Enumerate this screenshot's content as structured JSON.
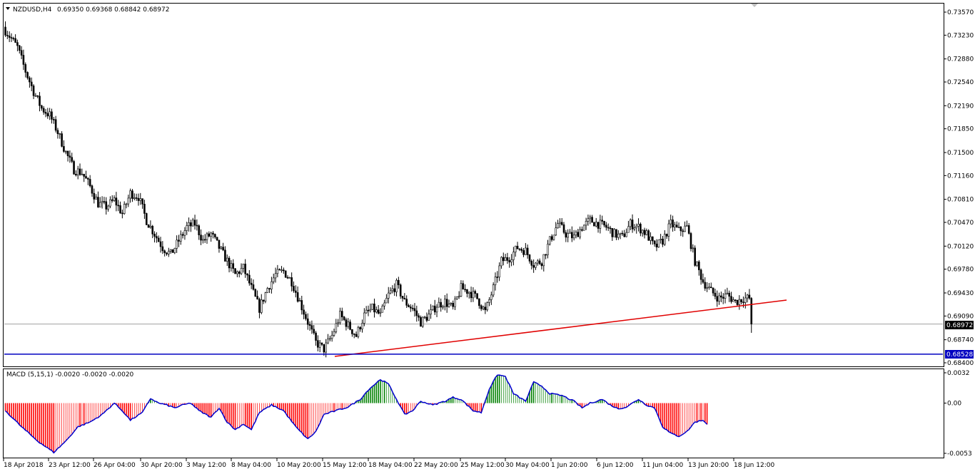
{
  "header": {
    "symbol": "NZDUSD,H4",
    "ohlc": "0.69350 0.69368 0.68842 0.68972"
  },
  "indicator": {
    "label": "MACD (5,15,1) -0.0020 -0.0020 -0.0020"
  },
  "colors": {
    "candle": "#000000",
    "trendline": "#e00000",
    "support": "#0000c0",
    "macd_up": "#008000",
    "macd_down": "#ff0000",
    "signal": "#0000cc",
    "bid_line": "#a0a0a0"
  },
  "chart_data": [
    {
      "type": "candlestick",
      "symbol": "NZDUSD",
      "timeframe": "H4",
      "ylim": [
        0.684,
        0.73717
      ],
      "y_ticks": [
        "0.73570",
        "0.73230",
        "0.72880",
        "0.72540",
        "0.72190",
        "0.71850",
        "0.71500",
        "0.71160",
        "0.70810",
        "0.70470",
        "0.70120",
        "0.69780",
        "0.69430",
        "0.69090",
        "0.68740",
        "0.68400"
      ],
      "x_ticks": [
        "18 Apr 2018",
        "23 Apr 12:00",
        "26 Apr 04:00",
        "30 Apr 20:00",
        "3 May 12:00",
        "8 May 04:00",
        "10 May 20:00",
        "15 May 12:00",
        "18 May 04:00",
        "22 May 20:00",
        "25 May 12:00",
        "30 May 04:00",
        "1 Jun 20:00",
        "6 Jun 12:00",
        "11 Jun 04:00",
        "13 Jun 20:00",
        "18 Jun 12:00"
      ],
      "current_price": "0.68972",
      "support_level": "0.68528",
      "trendline": {
        "start": [
          "15 May 12:00",
          0.6852
        ],
        "end": [
          "20 Jun",
          0.6932
        ]
      },
      "close_path": [
        [
          0,
          0.733
        ],
        [
          3,
          0.7318
        ],
        [
          6,
          0.7305
        ],
        [
          10,
          0.727
        ],
        [
          14,
          0.724
        ],
        [
          18,
          0.7215
        ],
        [
          22,
          0.7205
        ],
        [
          26,
          0.718
        ],
        [
          30,
          0.715
        ],
        [
          34,
          0.7125
        ],
        [
          38,
          0.712
        ],
        [
          42,
          0.71
        ],
        [
          46,
          0.7075
        ],
        [
          50,
          0.707
        ],
        [
          54,
          0.708
        ],
        [
          58,
          0.706
        ],
        [
          62,
          0.709
        ],
        [
          66,
          0.7085
        ],
        [
          70,
          0.705
        ],
        [
          74,
          0.703
        ],
        [
          78,
          0.701
        ],
        [
          82,
          0.7
        ],
        [
          86,
          0.702
        ],
        [
          90,
          0.704
        ],
        [
          94,
          0.7045
        ],
        [
          98,
          0.702
        ],
        [
          102,
          0.703
        ],
        [
          106,
          0.701
        ],
        [
          110,
          0.699
        ],
        [
          114,
          0.697
        ],
        [
          118,
          0.698
        ],
        [
          122,
          0.695
        ],
        [
          126,
          0.692
        ],
        [
          130,
          0.695
        ],
        [
          134,
          0.697
        ],
        [
          138,
          0.6975
        ],
        [
          142,
          0.696
        ],
        [
          146,
          0.693
        ],
        [
          150,
          0.69
        ],
        [
          154,
          0.687
        ],
        [
          158,
          0.686
        ],
        [
          162,
          0.688
        ],
        [
          166,
          0.691
        ],
        [
          170,
          0.6895
        ],
        [
          174,
          0.688
        ],
        [
          178,
          0.691
        ],
        [
          182,
          0.692
        ],
        [
          186,
          0.691
        ],
        [
          190,
          0.694
        ],
        [
          194,
          0.6955
        ],
        [
          198,
          0.693
        ],
        [
          202,
          0.692
        ],
        [
          206,
          0.69
        ],
        [
          210,
          0.691
        ],
        [
          214,
          0.6925
        ],
        [
          218,
          0.693
        ],
        [
          222,
          0.692
        ],
        [
          226,
          0.695
        ],
        [
          230,
          0.6945
        ],
        [
          234,
          0.6935
        ],
        [
          238,
          0.6915
        ],
        [
          242,
          0.695
        ],
        [
          246,
          0.699
        ],
        [
          250,
          0.6995
        ],
        [
          254,
          0.701
        ],
        [
          258,
          0.7005
        ],
        [
          262,
          0.6985
        ],
        [
          266,
          0.699
        ],
        [
          270,
          0.702
        ],
        [
          274,
          0.7045
        ],
        [
          278,
          0.703
        ],
        [
          282,
          0.7025
        ],
        [
          286,
          0.704
        ],
        [
          290,
          0.705
        ],
        [
          294,
          0.7045
        ],
        [
          298,
          0.704
        ],
        [
          302,
          0.703
        ],
        [
          306,
          0.7025
        ],
        [
          310,
          0.7045
        ],
        [
          314,
          0.704
        ],
        [
          318,
          0.703
        ],
        [
          322,
          0.701
        ],
        [
          326,
          0.702
        ],
        [
          330,
          0.7045
        ],
        [
          334,
          0.7035
        ],
        [
          338,
          0.704
        ],
        [
          342,
          0.699
        ],
        [
          346,
          0.696
        ],
        [
          350,
          0.6945
        ],
        [
          354,
          0.6935
        ],
        [
          358,
          0.694
        ],
        [
          362,
          0.693
        ],
        [
          366,
          0.6935
        ],
        [
          369,
          0.6935
        ],
        [
          370,
          0.68972
        ]
      ]
    },
    {
      "type": "histogram",
      "name": "MACD (5,15,1)",
      "values_text": "-0.0020 -0.0020 -0.0020",
      "ylim": [
        -0.0055,
        0.0033
      ],
      "y_ticks": [
        "0.0032",
        "0.00",
        "-0.0053"
      ],
      "anchors": [
        [
          0,
          -0.0008
        ],
        [
          8,
          -0.0025
        ],
        [
          16,
          -0.004
        ],
        [
          24,
          -0.0052
        ],
        [
          30,
          -0.004
        ],
        [
          36,
          -0.0025
        ],
        [
          42,
          -0.002
        ],
        [
          48,
          -0.0012
        ],
        [
          54,
          0.0
        ],
        [
          58,
          -0.0008
        ],
        [
          62,
          -0.0018
        ],
        [
          68,
          -0.001
        ],
        [
          72,
          0.0005
        ],
        [
          76,
          0.0
        ],
        [
          80,
          -0.0002
        ],
        [
          84,
          -0.0005
        ],
        [
          88,
          -0.0002
        ],
        [
          92,
          0.0
        ],
        [
          96,
          -0.0008
        ],
        [
          102,
          -0.0015
        ],
        [
          106,
          -0.0005
        ],
        [
          110,
          -0.002
        ],
        [
          114,
          -0.0028
        ],
        [
          118,
          -0.0022
        ],
        [
          122,
          -0.0028
        ],
        [
          126,
          -0.001
        ],
        [
          132,
          -0.0002
        ],
        [
          138,
          -0.0008
        ],
        [
          144,
          -0.0025
        ],
        [
          150,
          -0.0038
        ],
        [
          154,
          -0.003
        ],
        [
          158,
          -0.0012
        ],
        [
          164,
          -0.0008
        ],
        [
          170,
          -0.0004
        ],
        [
          176,
          0.0004
        ],
        [
          180,
          0.0014
        ],
        [
          186,
          0.0025
        ],
        [
          190,
          0.002
        ],
        [
          194,
          0.0004
        ],
        [
          198,
          -0.0012
        ],
        [
          202,
          -0.0008
        ],
        [
          206,
          0.0002
        ],
        [
          212,
          -0.0002
        ],
        [
          218,
          0.0002
        ],
        [
          222,
          0.0006
        ],
        [
          226,
          0.0004
        ],
        [
          232,
          -0.0008
        ],
        [
          236,
          -0.001
        ],
        [
          240,
          0.0015
        ],
        [
          244,
          0.003
        ],
        [
          248,
          0.0028
        ],
        [
          252,
          0.001
        ],
        [
          258,
          0.0002
        ],
        [
          262,
          0.0022
        ],
        [
          266,
          0.0018
        ],
        [
          270,
          0.001
        ],
        [
          276,
          0.0008
        ],
        [
          282,
          0.0002
        ],
        [
          286,
          -0.0005
        ],
        [
          290,
          0.0
        ],
        [
          296,
          0.0004
        ],
        [
          300,
          -0.0002
        ],
        [
          304,
          -0.0006
        ],
        [
          308,
          -0.0004
        ],
        [
          314,
          0.0004
        ],
        [
          318,
          -0.0002
        ],
        [
          322,
          -0.0005
        ],
        [
          326,
          -0.0025
        ],
        [
          330,
          -0.0032
        ],
        [
          334,
          -0.0035
        ],
        [
          338,
          -0.003
        ],
        [
          342,
          -0.002
        ],
        [
          346,
          -0.0018
        ],
        [
          348,
          -0.0022
        ]
      ]
    }
  ]
}
